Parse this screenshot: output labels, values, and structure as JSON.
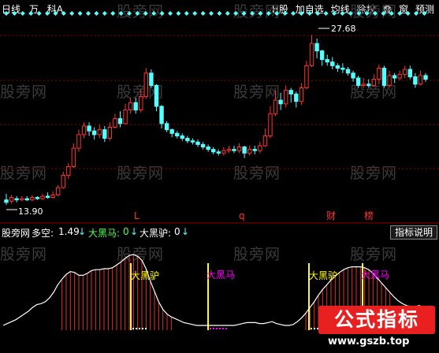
{
  "toolbar": {
    "left": [
      "日线",
      "万",
      "科A"
    ],
    "right": [
      "H股",
      "加自选",
      "均线",
      "除权",
      "叠",
      "窗",
      "预测"
    ]
  },
  "price_chart": {
    "high_label": "27.68",
    "low_label": "13.90",
    "event_markers": [
      "L",
      "q",
      "财",
      "榜"
    ]
  },
  "indicator": {
    "name": "股旁网",
    "duokong_label": "多空:",
    "duokong_value": "1.49",
    "dhm_label": "大黑马:",
    "dhm_value": "0",
    "dhl_label": "大黑驴:",
    "dhl_value": "0",
    "button": "指标说明",
    "annotations": [
      "大黑驴",
      "大黑马",
      "大黑驴",
      "大黑马"
    ]
  },
  "watermark": "股旁网",
  "logo": {
    "text": "公式指标",
    "url": "www.gszb.top"
  },
  "colors": {
    "up": "#ff3232",
    "down": "#54ffff",
    "signal": "#ffff00",
    "magenta": "#ff00ff",
    "grid": "#8b0000"
  },
  "chart_data": {
    "type": "candlestick",
    "candles": [
      [
        14.3,
        14.1,
        14.8,
        13.9
      ],
      [
        14.2,
        14.5,
        14.7,
        14.0
      ],
      [
        14.4,
        14.3,
        14.6,
        14.1
      ],
      [
        14.3,
        14.4,
        14.6,
        14.2
      ],
      [
        14.4,
        14.3,
        14.6,
        14.2
      ],
      [
        14.3,
        14.5,
        14.7,
        14.2
      ],
      [
        14.5,
        14.4,
        14.6,
        14.3
      ],
      [
        14.4,
        14.6,
        14.8,
        14.3
      ],
      [
        14.6,
        14.5,
        14.9,
        14.4
      ],
      [
        14.5,
        14.7,
        15.0,
        14.4
      ],
      [
        14.7,
        15.3,
        15.5,
        14.6
      ],
      [
        15.3,
        16.3,
        16.6,
        15.2
      ],
      [
        16.3,
        17.0,
        17.3,
        16.0
      ],
      [
        17.0,
        18.5,
        18.9,
        16.9
      ],
      [
        18.5,
        19.6,
        20.0,
        18.2
      ],
      [
        19.6,
        20.3,
        20.6,
        19.3
      ],
      [
        20.3,
        19.9,
        20.6,
        19.5
      ],
      [
        19.9,
        19.6,
        20.2,
        19.2
      ],
      [
        19.6,
        20.0,
        20.4,
        19.3
      ],
      [
        20.0,
        19.3,
        20.3,
        19.0
      ],
      [
        19.3,
        20.2,
        20.6,
        19.1
      ],
      [
        20.2,
        20.9,
        21.3,
        20.1
      ],
      [
        20.9,
        20.5,
        21.5,
        20.2
      ],
      [
        20.5,
        21.6,
        22.1,
        20.4
      ],
      [
        21.6,
        22.2,
        22.6,
        21.3
      ],
      [
        22.2,
        21.6,
        22.6,
        21.3
      ],
      [
        21.6,
        22.7,
        23.3,
        21.4
      ],
      [
        22.7,
        24.6,
        25.0,
        22.5
      ],
      [
        24.6,
        23.6,
        24.9,
        23.4
      ],
      [
        23.6,
        21.9,
        23.7,
        21.5
      ],
      [
        21.9,
        20.5,
        22.0,
        20.1
      ],
      [
        20.5,
        20.0,
        20.7,
        19.8
      ],
      [
        20.0,
        19.7,
        20.1,
        19.4
      ],
      [
        19.7,
        19.5,
        19.9,
        19.3
      ],
      [
        19.5,
        19.3,
        19.7,
        19.1
      ],
      [
        19.3,
        19.1,
        19.5,
        18.9
      ],
      [
        19.1,
        19.0,
        19.3,
        18.8
      ],
      [
        19.0,
        18.8,
        19.2,
        18.6
      ],
      [
        18.8,
        18.6,
        19.0,
        18.4
      ],
      [
        18.6,
        18.4,
        18.8,
        18.2
      ],
      [
        18.4,
        18.2,
        18.6,
        18.0
      ],
      [
        18.2,
        18.1,
        18.4,
        17.9
      ],
      [
        18.1,
        18.3,
        18.6,
        17.9
      ],
      [
        18.3,
        18.4,
        18.7,
        18.1
      ],
      [
        18.4,
        18.3,
        18.7,
        18.1
      ],
      [
        18.3,
        18.6,
        18.9,
        18.1
      ],
      [
        18.6,
        18.1,
        18.7,
        17.7
      ],
      [
        18.1,
        18.4,
        18.7,
        17.9
      ],
      [
        18.4,
        18.3,
        18.7,
        18.0
      ],
      [
        18.3,
        18.7,
        19.0,
        18.1
      ],
      [
        18.7,
        19.5,
        20.1,
        18.6
      ],
      [
        19.5,
        21.3,
        21.9,
        19.3
      ],
      [
        21.3,
        22.4,
        23.2,
        21.1
      ],
      [
        22.4,
        22.1,
        23.0,
        21.6
      ],
      [
        22.1,
        23.2,
        23.6,
        21.8
      ],
      [
        23.2,
        22.9,
        23.4,
        22.2
      ],
      [
        22.9,
        22.3,
        23.1,
        21.8
      ],
      [
        22.3,
        23.4,
        23.8,
        22.0
      ],
      [
        23.4,
        25.2,
        25.6,
        23.3
      ],
      [
        25.2,
        27.0,
        27.7,
        25.1
      ],
      [
        27.0,
        26.4,
        27.4,
        25.8
      ],
      [
        26.4,
        25.7,
        26.5,
        25.2
      ],
      [
        25.7,
        25.5,
        26.1,
        25.2
      ],
      [
        25.5,
        25.2,
        25.9,
        24.9
      ],
      [
        25.2,
        25.0,
        25.4,
        24.7
      ],
      [
        25.0,
        24.9,
        25.4,
        24.6
      ],
      [
        24.9,
        24.6,
        25.1,
        24.4
      ],
      [
        24.6,
        24.2,
        24.8,
        23.9
      ],
      [
        24.2,
        23.6,
        24.4,
        23.4
      ],
      [
        23.6,
        23.7,
        24.2,
        23.4
      ],
      [
        23.7,
        23.6,
        24.1,
        23.4
      ],
      [
        23.6,
        24.1,
        24.5,
        23.5
      ],
      [
        24.1,
        25.0,
        25.3,
        23.7
      ],
      [
        25.0,
        23.6,
        25.2,
        23.4
      ],
      [
        23.6,
        24.4,
        24.8,
        23.4
      ],
      [
        24.4,
        24.2,
        24.6,
        23.8
      ],
      [
        24.2,
        24.5,
        24.8,
        24.0
      ],
      [
        24.5,
        24.9,
        25.2,
        24.2
      ],
      [
        24.9,
        24.3,
        25.2,
        24.1
      ],
      [
        24.3,
        23.7,
        24.6,
        23.4
      ],
      [
        23.7,
        24.4,
        24.8,
        23.6
      ],
      [
        24.4,
        24.1,
        24.6,
        23.9
      ]
    ],
    "price_range": [
      13.0,
      29.0
    ],
    "oscillator": [
      0.05,
      0.07,
      0.09,
      0.11,
      0.14,
      0.17,
      0.2,
      0.24,
      0.27,
      0.28,
      0.3,
      0.34,
      0.4,
      0.48,
      0.54,
      0.59,
      0.62,
      0.61,
      0.58,
      0.58,
      0.6,
      0.63,
      0.64,
      0.64,
      0.65,
      0.65,
      0.66,
      0.69,
      0.72,
      0.76,
      0.79,
      0.8,
      0.78,
      0.74,
      0.65,
      0.52,
      0.41,
      0.3,
      0.22,
      0.17,
      0.14,
      0.12,
      0.1,
      0.08,
      0.07,
      0.06,
      0.05,
      0.05,
      0.05,
      0.05,
      0.05,
      0.05,
      0.05,
      0.05,
      0.05,
      0.05,
      0.06,
      0.07,
      0.08,
      0.08,
      0.08,
      0.07,
      0.07,
      0.08,
      0.09,
      0.07,
      0.06,
      0.05,
      0.05,
      0.06,
      0.09,
      0.13,
      0.18,
      0.24,
      0.3,
      0.37,
      0.43,
      0.48,
      0.53,
      0.57,
      0.61,
      0.64,
      0.66,
      0.67,
      0.67,
      0.67,
      0.66,
      0.64,
      0.6,
      0.55,
      0.5,
      0.45,
      0.4,
      0.35,
      0.31,
      0.28,
      0.26,
      0.25,
      0.25,
      0.26,
      0.24,
      0.22,
      0.2
    ],
    "oscillator_range": [
      0,
      1.0
    ]
  }
}
